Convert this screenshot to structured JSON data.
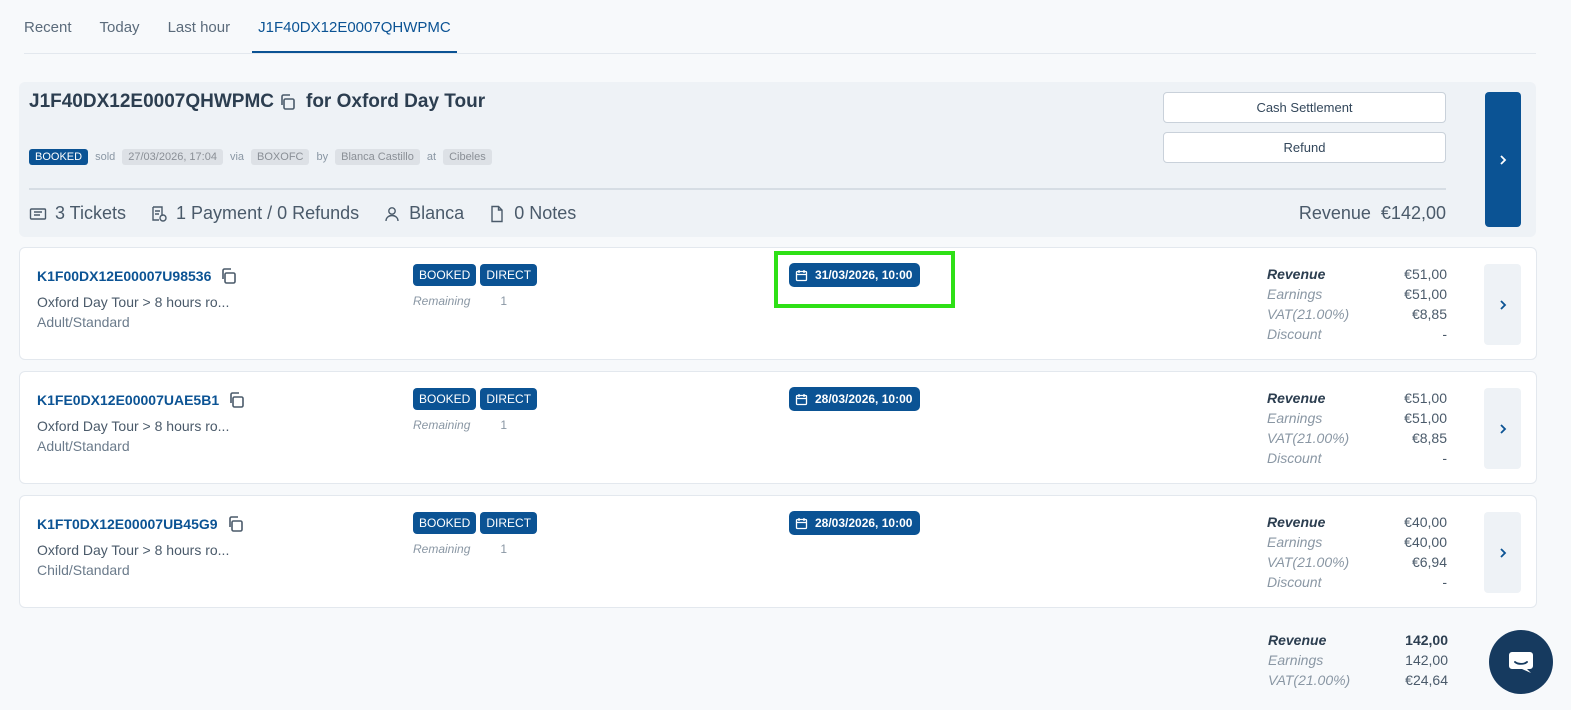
{
  "tabs": [
    "Recent",
    "Today",
    "Last hour",
    "J1F40DX12E0007QHWPMC"
  ],
  "order": {
    "code": "J1F40DX12E0007QHWPMC",
    "for_text": "for Oxford Day Tour",
    "status": "BOOKED",
    "sold_label": "sold",
    "sold_date": "27/03/2026, 17:04",
    "via_label": "via",
    "via": "BOXOFC",
    "by_label": "by",
    "by": "Blanca Castillo",
    "at_label": "at",
    "at": "Cibeles",
    "tickets": "3 Tickets",
    "payments": "1 Payment / 0 Refunds",
    "user": "Blanca",
    "notes": "0 Notes",
    "revenue_label": "Revenue",
    "revenue": "€142,00",
    "cash_settlement": "Cash Settlement",
    "refund": "Refund"
  },
  "tickets": [
    {
      "code": "K1F00DX12E00007U98536",
      "product": "Oxford Day Tour > 8 hours ro...",
      "variant": "Adult/Standard",
      "status": "BOOKED",
      "channel": "DIRECT",
      "remaining_label": "Remaining",
      "remaining": "1",
      "date": "31/03/2026, 10:00",
      "revenue_label": "Revenue",
      "revenue": "€51,00",
      "earnings_label": "Earnings",
      "earnings": "€51,00",
      "vat_label": "VAT(21.00%)",
      "vat": "€8,85",
      "discount_label": "Discount",
      "discount": "-"
    },
    {
      "code": "K1FE0DX12E00007UAE5B1",
      "product": "Oxford Day Tour > 8 hours ro...",
      "variant": "Adult/Standard",
      "status": "BOOKED",
      "channel": "DIRECT",
      "remaining_label": "Remaining",
      "remaining": "1",
      "date": "28/03/2026, 10:00",
      "revenue_label": "Revenue",
      "revenue": "€51,00",
      "earnings_label": "Earnings",
      "earnings": "€51,00",
      "vat_label": "VAT(21.00%)",
      "vat": "€8,85",
      "discount_label": "Discount",
      "discount": "-"
    },
    {
      "code": "K1FT0DX12E00007UB45G9",
      "product": "Oxford Day Tour > 8 hours ro...",
      "variant": "Child/Standard",
      "status": "BOOKED",
      "channel": "DIRECT",
      "remaining_label": "Remaining",
      "remaining": "1",
      "date": "28/03/2026, 10:00",
      "revenue_label": "Revenue",
      "revenue": "€40,00",
      "earnings_label": "Earnings",
      "earnings": "€40,00",
      "vat_label": "VAT(21.00%)",
      "vat": "€6,94",
      "discount_label": "Discount",
      "discount": "-"
    }
  ],
  "totals": {
    "revenue_label": "Revenue",
    "revenue": "142,00",
    "earnings_label": "Earnings",
    "earnings": "142,00",
    "vat_label": "VAT(21.00%)",
    "vat": "€24,64"
  },
  "colors": {
    "primary": "#0b5394",
    "highlight": "#2ee016",
    "chat": "#163a5f"
  },
  "icons": [
    "copy-icon",
    "ticket-icon",
    "payment-icon",
    "user-icon",
    "notes-icon",
    "calendar-icon",
    "chevron-right-icon",
    "chat-icon"
  ]
}
